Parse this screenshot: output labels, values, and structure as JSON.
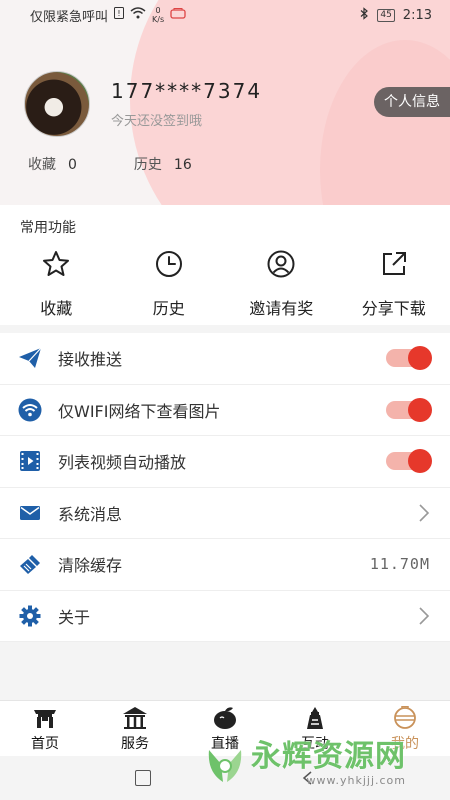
{
  "status_bar": {
    "carrier": "仅限紧急呼叫",
    "net_speed_value": "0",
    "net_speed_unit": "K/s",
    "battery": "45",
    "time": "2:13"
  },
  "profile": {
    "phone": "177****7374",
    "signin_text": "今天还没签到哦",
    "info_button": "个人信息",
    "stats": [
      {
        "label": "收藏",
        "value": "0"
      },
      {
        "label": "历史",
        "value": "16"
      }
    ]
  },
  "common": {
    "title": "常用功能",
    "items": [
      {
        "label": "收藏",
        "icon": "star-icon"
      },
      {
        "label": "历史",
        "icon": "clock-icon"
      },
      {
        "label": "邀请有奖",
        "icon": "user-icon"
      },
      {
        "label": "分享下载",
        "icon": "share-icon"
      }
    ]
  },
  "settings": {
    "rows": [
      {
        "label": "接收推送",
        "icon": "paper-plane-icon",
        "control": "toggle",
        "on": true
      },
      {
        "label": "仅WIFI网络下查看图片",
        "icon": "wifi-icon",
        "control": "toggle",
        "on": true
      },
      {
        "label": "列表视频自动播放",
        "icon": "film-icon",
        "control": "toggle",
        "on": true
      },
      {
        "label": "系统消息",
        "icon": "mail-icon",
        "control": "chevron"
      },
      {
        "label": "清除缓存",
        "icon": "broom-icon",
        "control": "value",
        "value": "11.70M"
      },
      {
        "label": "关于",
        "icon": "gear-icon",
        "control": "chevron"
      }
    ]
  },
  "bottom_nav": {
    "items": [
      {
        "label": "首页",
        "icon": "home-gate-icon",
        "active": false
      },
      {
        "label": "服务",
        "icon": "pavilion-icon",
        "active": false
      },
      {
        "label": "直播",
        "icon": "fruit-icon",
        "active": false
      },
      {
        "label": "互动",
        "icon": "tower-icon",
        "active": false
      },
      {
        "label": "我的",
        "icon": "profile-lantern-icon",
        "active": true
      }
    ]
  },
  "watermark": {
    "brand": "永辉资源网",
    "url": "www.yhkjjj.com"
  },
  "colors": {
    "accent_red": "#e6382b",
    "toggle_track": "#f4b3ab",
    "icon_blue": "#1f5fa8",
    "active_nav": "#c9925a",
    "header_pink": "#fbd5d5"
  }
}
